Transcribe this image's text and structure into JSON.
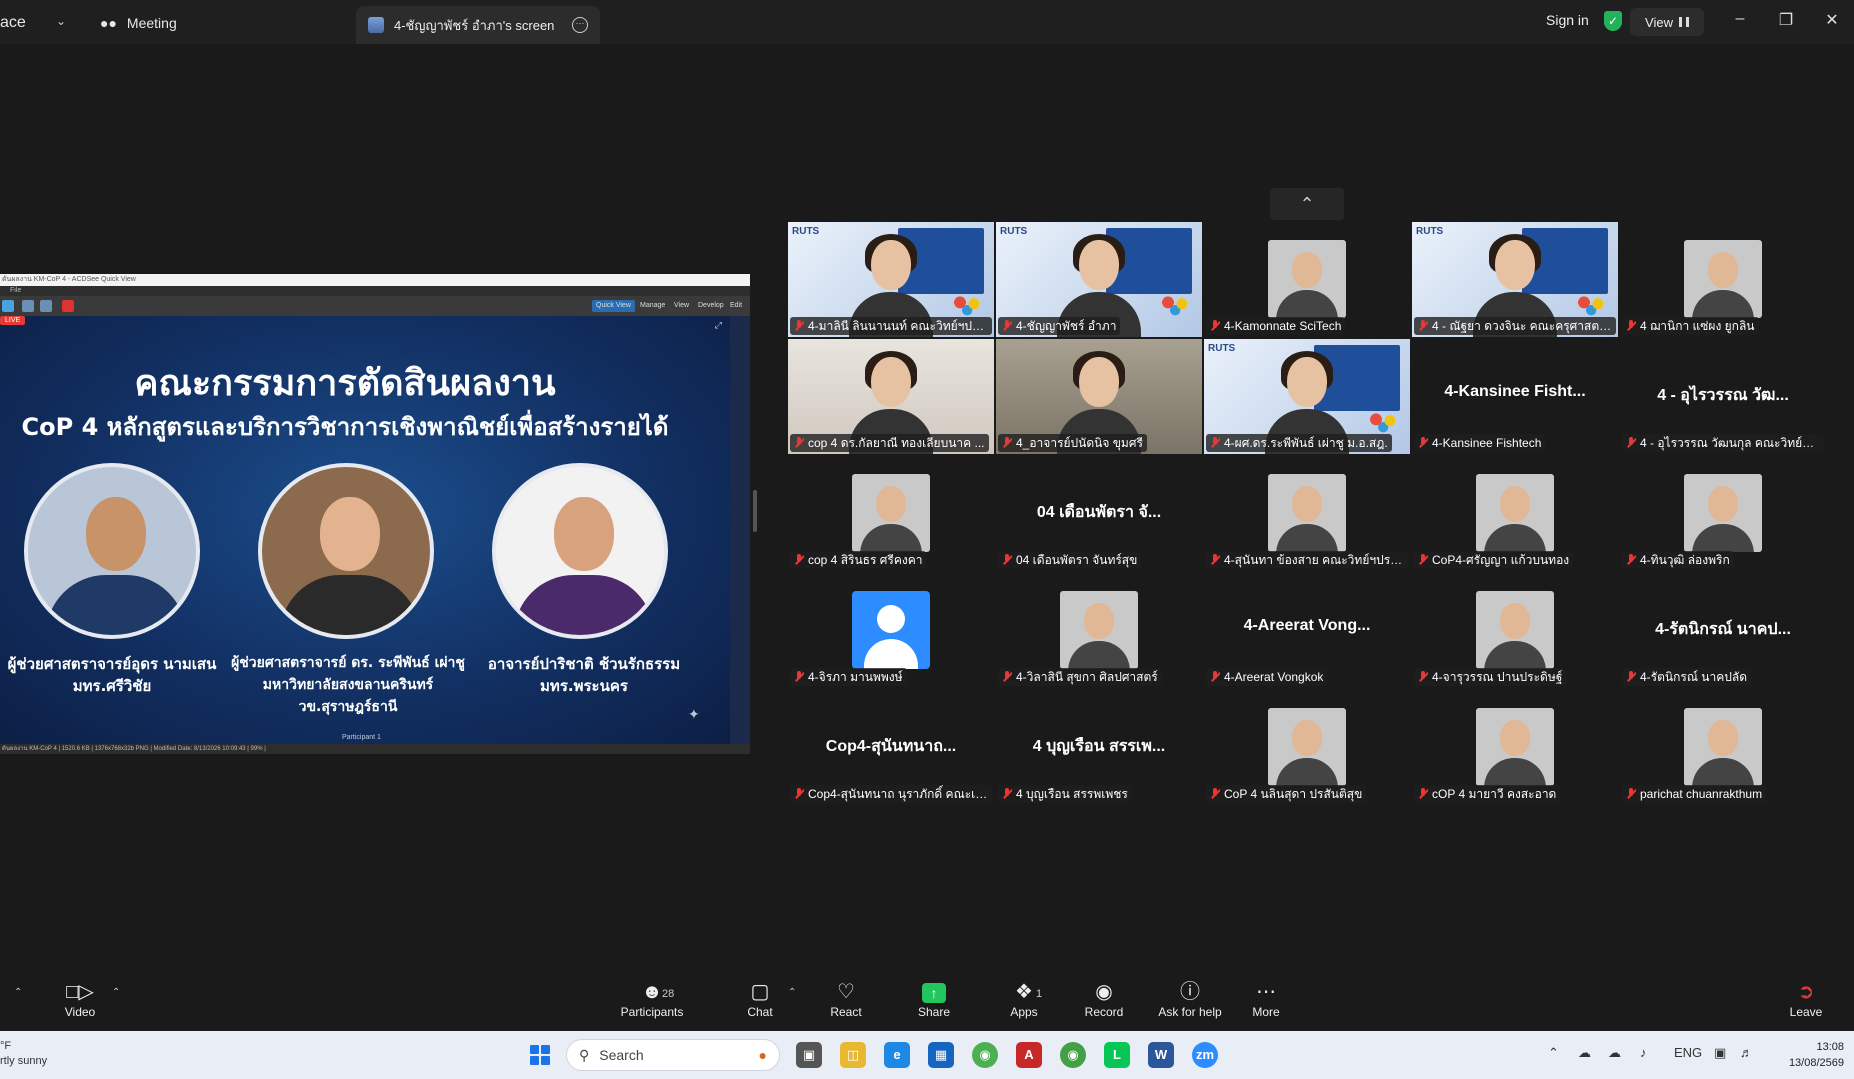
{
  "titlebar": {
    "app_name": "ace",
    "meeting_tab": "Meeting",
    "screen_tab": "4-ชัญญาพัชร์ อำภา's screen",
    "sign_in": "Sign in",
    "view": "View"
  },
  "shared_screen": {
    "window_title": "ดันผลงาน KM-CoP 4 - ACDSee Quick View",
    "menu": "File",
    "live": "LIVE",
    "toolbar_tabs": [
      "Quick View",
      "Manage",
      "View",
      "Develop",
      "Edit"
    ],
    "slide_title": "คณะกรรมการตัดสินผลงาน",
    "slide_subtitle": "CoP 4 หลักสูตรและบริการวิชาการเชิงพาณิชย์เพื่อสร้างรายได้",
    "judges": [
      {
        "name": "ผู้ช่วยศาสตราจารย์อุดร นามเสน",
        "affiliation": "มทร.ศรีวิชัย"
      },
      {
        "name": "ผู้ช่วยศาสตราจารย์ ดร. ระพีพันธ์ เผ่าชู",
        "affiliation": "มหาวิทยาลัยสงขลานครินทร์ วข.สุราษฎร์ธานี"
      },
      {
        "name": "อาจารย์ปาริชาติ ช้วนรักธรรม",
        "affiliation": "มทร.พระนคร"
      }
    ],
    "participant_label": "Participant 1",
    "status": "ดันผลงาน KM-CoP 4 | 1520.6 KB | 1376x768x32b PNG | Modified Date: 8/13/2026 10:09:43 | 99% |"
  },
  "gallery": {
    "tiles": [
      {
        "kind": "video",
        "big": "",
        "label": "4-มาลินี ลินนานนท์ คณะวิทย์ฯปรมะ"
      },
      {
        "kind": "video",
        "big": "",
        "label": "4-ชัญญาพัชร์ อำภา"
      },
      {
        "kind": "thumb",
        "big": "",
        "label": "4-Kamonnate SciTech"
      },
      {
        "kind": "video",
        "big": "",
        "label": "4 - ณัฐยา ดวงจินะ คณะครุศาสตร์ฯ"
      },
      {
        "kind": "thumb",
        "big": "",
        "label": "4 ฌานิกา แซ่ผง ยูกลิน"
      },
      {
        "kind": "video",
        "big": "",
        "label": "cop 4 ดร.กัลยาณี ทองเลียบนาค ..."
      },
      {
        "kind": "video",
        "big": "",
        "label": "4_อาจารย์ปนัดนิจ ขุมศรี"
      },
      {
        "kind": "video",
        "big": "",
        "label": "4-ผศ.ดร.ระพีพันธ์ เผ่าชู ม.อ.สฎ."
      },
      {
        "kind": "name",
        "big": "4-Kansinee Fisht...",
        "label": "4-Kansinee Fishtech"
      },
      {
        "kind": "name",
        "big": "4 - อุไรวรรณ วัฒ...",
        "label": "4 - อุไรวรรณ วัฒนกุล คณะวิทย์ปร..."
      },
      {
        "kind": "thumb",
        "big": "",
        "label": "cop 4 สิรินธร ศรีคงคา"
      },
      {
        "kind": "name",
        "big": "04 เดือนพัตรา จั...",
        "label": "04 เดือนพัตรา จันทร์สุข"
      },
      {
        "kind": "thumb",
        "big": "",
        "label": "4-สุนันทา ข้องสาย คณะวิทย์ฯปรมะ"
      },
      {
        "kind": "thumb",
        "big": "",
        "label": "CoP4-ศรัญญา แก้วบนทอง"
      },
      {
        "kind": "thumb",
        "big": "",
        "label": "4-ทินวุฒิ ล่องพริก"
      },
      {
        "kind": "avatar",
        "big": "",
        "label": "4-จิรภา มานพพงษ์"
      },
      {
        "kind": "thumb",
        "big": "",
        "label": "4-วิลาสินี สุขกา ศิลปศาสตร์"
      },
      {
        "kind": "name",
        "big": "4-Areerat Vong...",
        "label": "4-Areerat Vongkok"
      },
      {
        "kind": "thumb",
        "big": "",
        "label": "4-จารุวรรณ ปานประดิษฐ์"
      },
      {
        "kind": "name",
        "big": "4-รัตนิกรณ์ นาคป...",
        "label": "4-รัตนิกรณ์ นาคปลัด"
      },
      {
        "kind": "name",
        "big": "Cop4-สุนันทนาถ...",
        "label": "Cop4-สุนันทนาถ นุราภักดิ์ คณะเก..."
      },
      {
        "kind": "name",
        "big": "4 บุญเรือน สรรเพ...",
        "label": "4 บุญเรือน สรรพเพชร"
      },
      {
        "kind": "thumb",
        "big": "",
        "label": "CoP 4 นลินสุดา ปรสันติสุข"
      },
      {
        "kind": "thumb",
        "big": "",
        "label": "cOP 4 มายาวี คงสะอาด"
      },
      {
        "kind": "thumb",
        "big": "",
        "label": "parichat chuanrakthum"
      }
    ]
  },
  "toolbar": {
    "video": "Video",
    "participants": "Participants",
    "participants_count": "28",
    "chat": "Chat",
    "react": "React",
    "share": "Share",
    "apps": "Apps",
    "apps_count": "1",
    "record": "Record",
    "ask_for_help": "Ask for help",
    "more": "More",
    "leave": "Leave"
  },
  "taskbar": {
    "temp": "°F",
    "weather": "rtly sunny",
    "search_placeholder": "Search",
    "language": "ENG",
    "time": "13:08",
    "date": "13/08/2569"
  },
  "colors": {
    "active_speaker": "#22c55e",
    "share_green": "#22c55e",
    "muted_red": "#e53935",
    "zoom_blue": "#2d8cff"
  }
}
